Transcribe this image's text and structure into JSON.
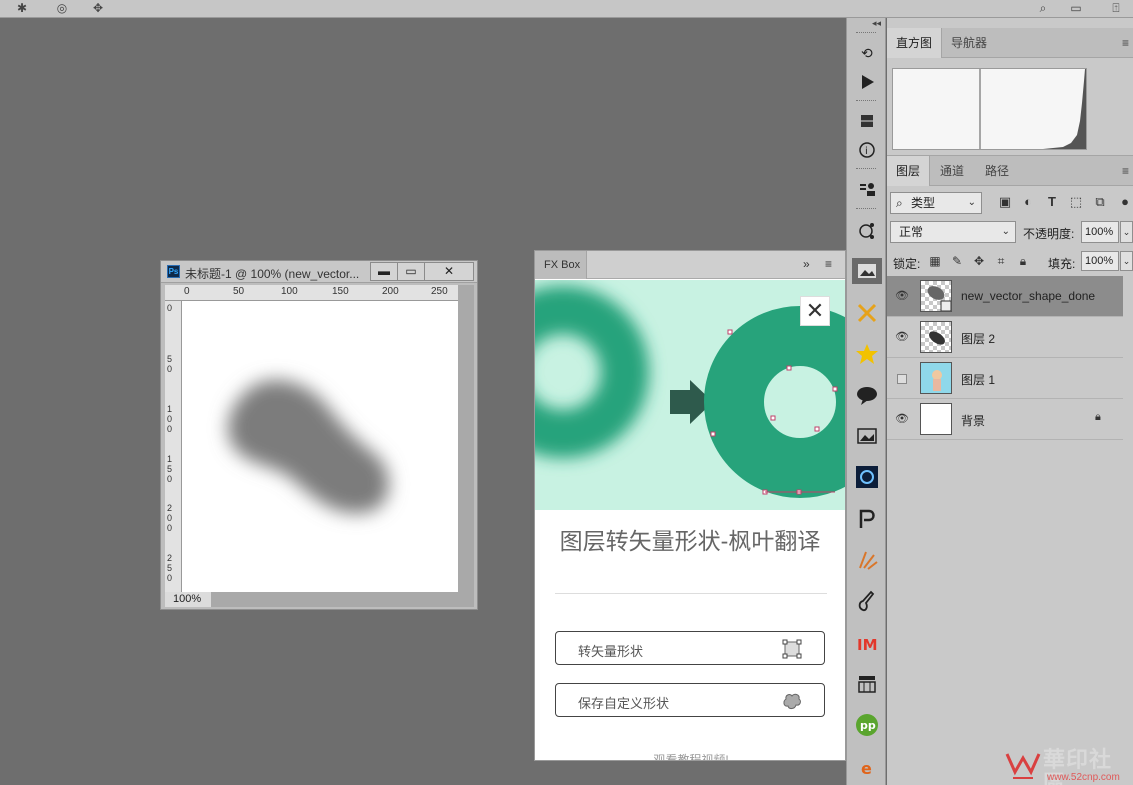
{
  "topbar": {
    "icons": [
      "gear-icon",
      "target-icon",
      "butterfly-icon",
      "search-icon",
      "workspace-icon",
      "share-icon"
    ]
  },
  "document": {
    "title": "未标题-1 @ 100% (new_vector...",
    "logo": "Ps",
    "minimize": "▬",
    "restore": "▭",
    "close": "✕",
    "ruler_top": [
      "0",
      "50",
      "100",
      "150",
      "200",
      "250"
    ],
    "ruler_left": [
      "0",
      "50",
      "100",
      "150",
      "200",
      "250"
    ],
    "zoom": "100%"
  },
  "fxbox": {
    "tab": "FX Box",
    "collapse": "»",
    "menu": "≡",
    "close": "✕",
    "title": "图层转矢量形状-枫叶翻译",
    "button1": "转矢量形状",
    "button2": "保存自定义形状",
    "footer": "观看教程视频!",
    "colors": {
      "hero_bg": "#c8f2e2",
      "ring": "#27a37b",
      "arrow": "#2e5a4c"
    }
  },
  "strip": {
    "collapse": "◂◂",
    "icons": [
      "history-icon",
      "play-icon",
      "3d-box-icon",
      "info-icon",
      "clone-source-icon",
      "adjustment-icon",
      "image-layer-icon",
      "crossed-tools-icon",
      "star-icon",
      "speech-bubble-icon",
      "image-frame-icon",
      "circle-plugin-icon",
      "p-logo-icon",
      "brush-burst-icon",
      "guitar-icon",
      "im-logo-icon",
      "shop-icon",
      "pp-logo-icon",
      "e-logo-icon"
    ]
  },
  "panels": {
    "histogram_tabs": [
      "直方图",
      "导航器"
    ],
    "layers_tabs": [
      "图层",
      "通道",
      "路径"
    ],
    "panel_menu": "≡",
    "filter_label": "类型",
    "blend_mode": "正常",
    "opacity_label": "不透明度:",
    "opacity": "100%",
    "lock_label": "锁定:",
    "fill_label": "填充:",
    "fill": "100%",
    "layers": [
      {
        "name": "new_vector_shape_done",
        "visible": true,
        "selected": true
      },
      {
        "name": "图层 2",
        "visible": true,
        "selected": false
      },
      {
        "name": "图层 1",
        "visible": false,
        "selected": false
      },
      {
        "name": "背景",
        "visible": true,
        "selected": false,
        "locked": true
      }
    ]
  },
  "watermark": {
    "text": "華印社區",
    "url": "www.52cnp.com"
  }
}
